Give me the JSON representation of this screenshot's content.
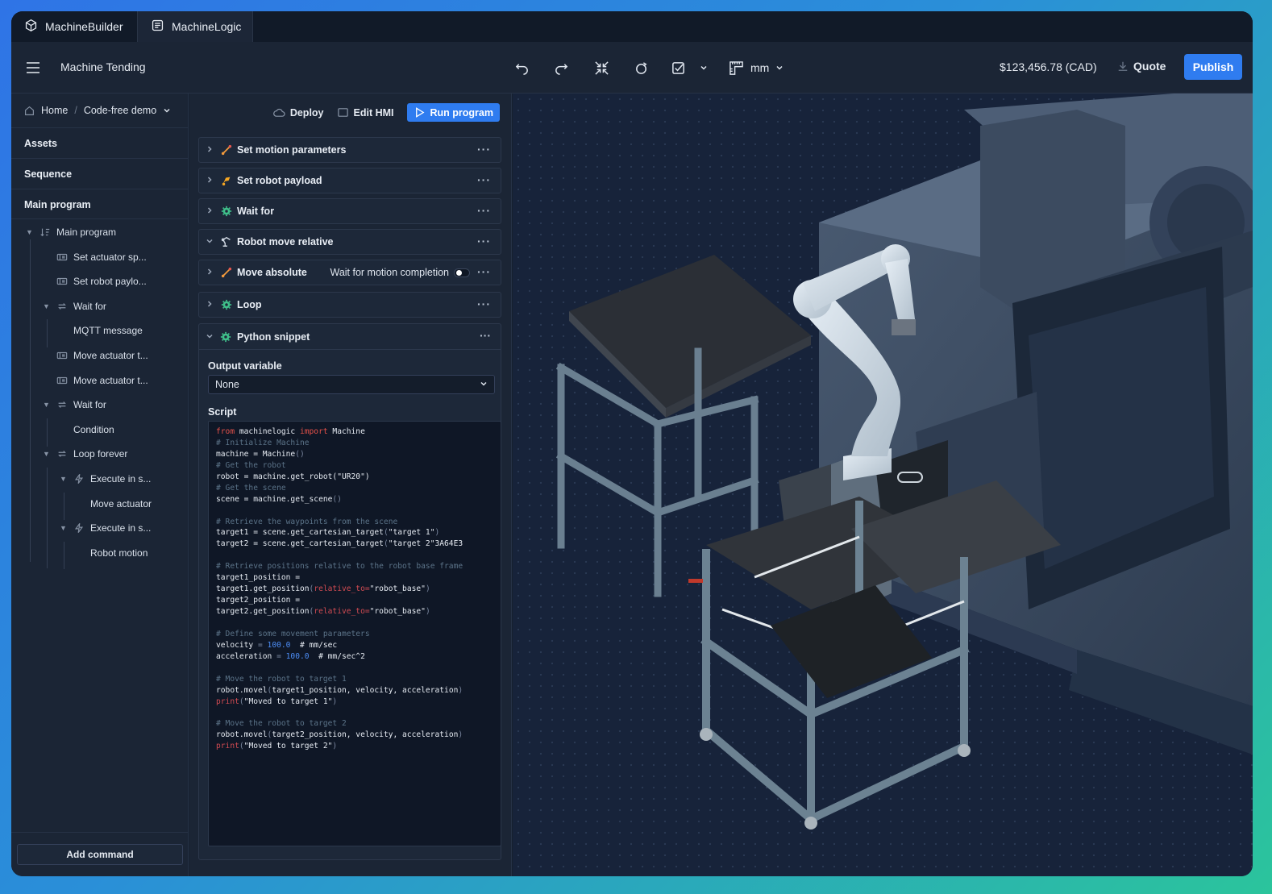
{
  "tabs": [
    {
      "label": "MachineBuilder",
      "icon": "cube-icon"
    },
    {
      "label": "MachineLogic",
      "icon": "list-icon"
    }
  ],
  "toolbar": {
    "project_title": "Machine Tending",
    "units": "mm",
    "price": "$123,456.78 (CAD)",
    "quote_label": "Quote",
    "publish_label": "Publish"
  },
  "sidebar": {
    "breadcrumb": {
      "home": "Home",
      "current": "Code-free demo"
    },
    "sections": [
      "Assets",
      "Sequence",
      "Main program"
    ],
    "tree": [
      {
        "label": "Main program",
        "depth": 0,
        "icon": "sort-icon",
        "expanded": true
      },
      {
        "label": "Set actuator sp...",
        "depth": 1,
        "icon": "actuator-icon"
      },
      {
        "label": "Set robot paylo...",
        "depth": 1,
        "icon": "actuator-icon"
      },
      {
        "label": "Wait for",
        "depth": 1,
        "icon": "loop-icon",
        "expanded": true
      },
      {
        "label": "MQTT message",
        "depth": 2,
        "icon": ""
      },
      {
        "label": "Move actuator t...",
        "depth": 1,
        "icon": "actuator-icon"
      },
      {
        "label": "Move actuator t...",
        "depth": 1,
        "icon": "actuator-icon"
      },
      {
        "label": "Wait for",
        "depth": 1,
        "icon": "loop-icon",
        "expanded": true
      },
      {
        "label": "Condition",
        "depth": 2,
        "icon": ""
      },
      {
        "label": "Loop forever",
        "depth": 1,
        "icon": "loop-icon",
        "expanded": true
      },
      {
        "label": "Execute in s...",
        "depth": 2,
        "icon": "bolt-icon",
        "expanded": true
      },
      {
        "label": "Move actuator",
        "depth": 3,
        "icon": ""
      },
      {
        "label": "Execute in s...",
        "depth": 2,
        "icon": "bolt-icon",
        "expanded": true
      },
      {
        "label": "Robot motion",
        "depth": 3,
        "icon": ""
      }
    ],
    "add_command_label": "Add command"
  },
  "program": {
    "actions": {
      "deploy": "Deploy",
      "edit_hmi": "Edit HMI",
      "run": "Run program"
    },
    "steps": [
      {
        "label": "Set motion parameters",
        "icon": "motion-icon",
        "expanded": false
      },
      {
        "label": "Set robot payload",
        "icon": "payload-icon",
        "expanded": false
      },
      {
        "label": "Wait for",
        "icon": "gear-icon",
        "expanded": false
      },
      {
        "label": "Robot move relative",
        "icon": "robot-arm-icon",
        "expanded": true
      },
      {
        "label": "Move absolute",
        "icon": "motion-icon",
        "expanded": false,
        "extra": "Wait for motion completion"
      },
      {
        "label": "Loop",
        "icon": "gear-icon",
        "expanded": false
      }
    ],
    "python": {
      "label": "Python snippet",
      "output_variable_label": "Output variable",
      "output_variable_value": "None",
      "script_label": "Script",
      "code": [
        [
          [
            "kw",
            "from"
          ],
          [
            "st",
            " machinelogic "
          ],
          [
            "kw",
            "import"
          ],
          [
            "st",
            " Machine"
          ]
        ],
        [
          [
            "cm",
            "# Initialize Machine"
          ]
        ],
        [
          [
            "st",
            "machine = Machine"
          ],
          [
            "pn",
            "()"
          ]
        ],
        [
          [
            "cm",
            "# Get the robot"
          ]
        ],
        [
          [
            "st",
            "robot = machine.get_robot("
          ],
          [
            "st",
            "\"UR20\""
          ],
          [
            "st",
            ")"
          ]
        ],
        [
          [
            "cm",
            "# Get the scene"
          ]
        ],
        [
          [
            "st",
            "scene = machine.get_scene"
          ],
          [
            "pn",
            "()"
          ]
        ],
        [],
        [
          [
            "cm",
            "# Retrieve the waypoints from the scene"
          ]
        ],
        [
          [
            "st",
            "target1 = scene.get_cartesian_target"
          ],
          [
            "pn",
            "("
          ],
          [
            "st",
            "\"target 1\""
          ],
          [
            "pn",
            ")"
          ]
        ],
        [
          [
            "st",
            "target2 = scene.get_cartesian_target"
          ],
          [
            "pn",
            "("
          ],
          [
            "st",
            "\"target 2\"3A64E3"
          ]
        ],
        [],
        [
          [
            "cm",
            "# Retrieve positions relative to the robot base frame"
          ]
        ],
        [
          [
            "st",
            "target1_position ="
          ]
        ],
        [
          [
            "st",
            "target1.get_position"
          ],
          [
            "pn",
            "("
          ],
          [
            "fn",
            "relative_to="
          ],
          [
            "st",
            "\"robot_base\""
          ],
          [
            "pn",
            ")"
          ]
        ],
        [
          [
            "st",
            "target2_position ="
          ]
        ],
        [
          [
            "st",
            "target2.get_position"
          ],
          [
            "pn",
            "("
          ],
          [
            "fn",
            "relative_to="
          ],
          [
            "st",
            "\"robot_base\""
          ],
          [
            "pn",
            ")"
          ]
        ],
        [],
        [
          [
            "cm",
            "# Define some movement parameters"
          ]
        ],
        [
          [
            "st",
            "velocity "
          ],
          [
            "pn",
            "="
          ],
          [
            "st",
            " "
          ],
          [
            "num",
            "100.0"
          ],
          [
            "st",
            "  # mm/sec"
          ]
        ],
        [
          [
            "st",
            "acceleration "
          ],
          [
            "pn",
            "="
          ],
          [
            "st",
            " "
          ],
          [
            "num",
            "100.0"
          ],
          [
            "st",
            "  # mm/sec^2"
          ]
        ],
        [],
        [
          [
            "cm",
            "# Move the robot to target 1"
          ]
        ],
        [
          [
            "st",
            "robot.movel"
          ],
          [
            "pn",
            "("
          ],
          [
            "st",
            "target1_position, velocity, acceleration"
          ],
          [
            "pn",
            ")"
          ]
        ],
        [
          [
            "fn",
            "print"
          ],
          [
            "pn",
            "("
          ],
          [
            "st",
            "\"Moved to target 1\""
          ],
          [
            "pn",
            ")"
          ]
        ],
        [],
        [
          [
            "cm",
            "# Move the robot to target 2"
          ]
        ],
        [
          [
            "st",
            "robot.movel"
          ],
          [
            "pn",
            "("
          ],
          [
            "st",
            "target2_position, velocity, acceleration"
          ],
          [
            "pn",
            ")"
          ]
        ],
        [
          [
            "fn",
            "print"
          ],
          [
            "pn",
            "("
          ],
          [
            "st",
            "\"Moved to target 2\""
          ],
          [
            "pn",
            ")"
          ]
        ]
      ]
    }
  },
  "colors": {
    "accent": "#2f7cf0",
    "panel": "#1b2535",
    "viewport": "#17233a",
    "code_bg": "#0f1726"
  }
}
